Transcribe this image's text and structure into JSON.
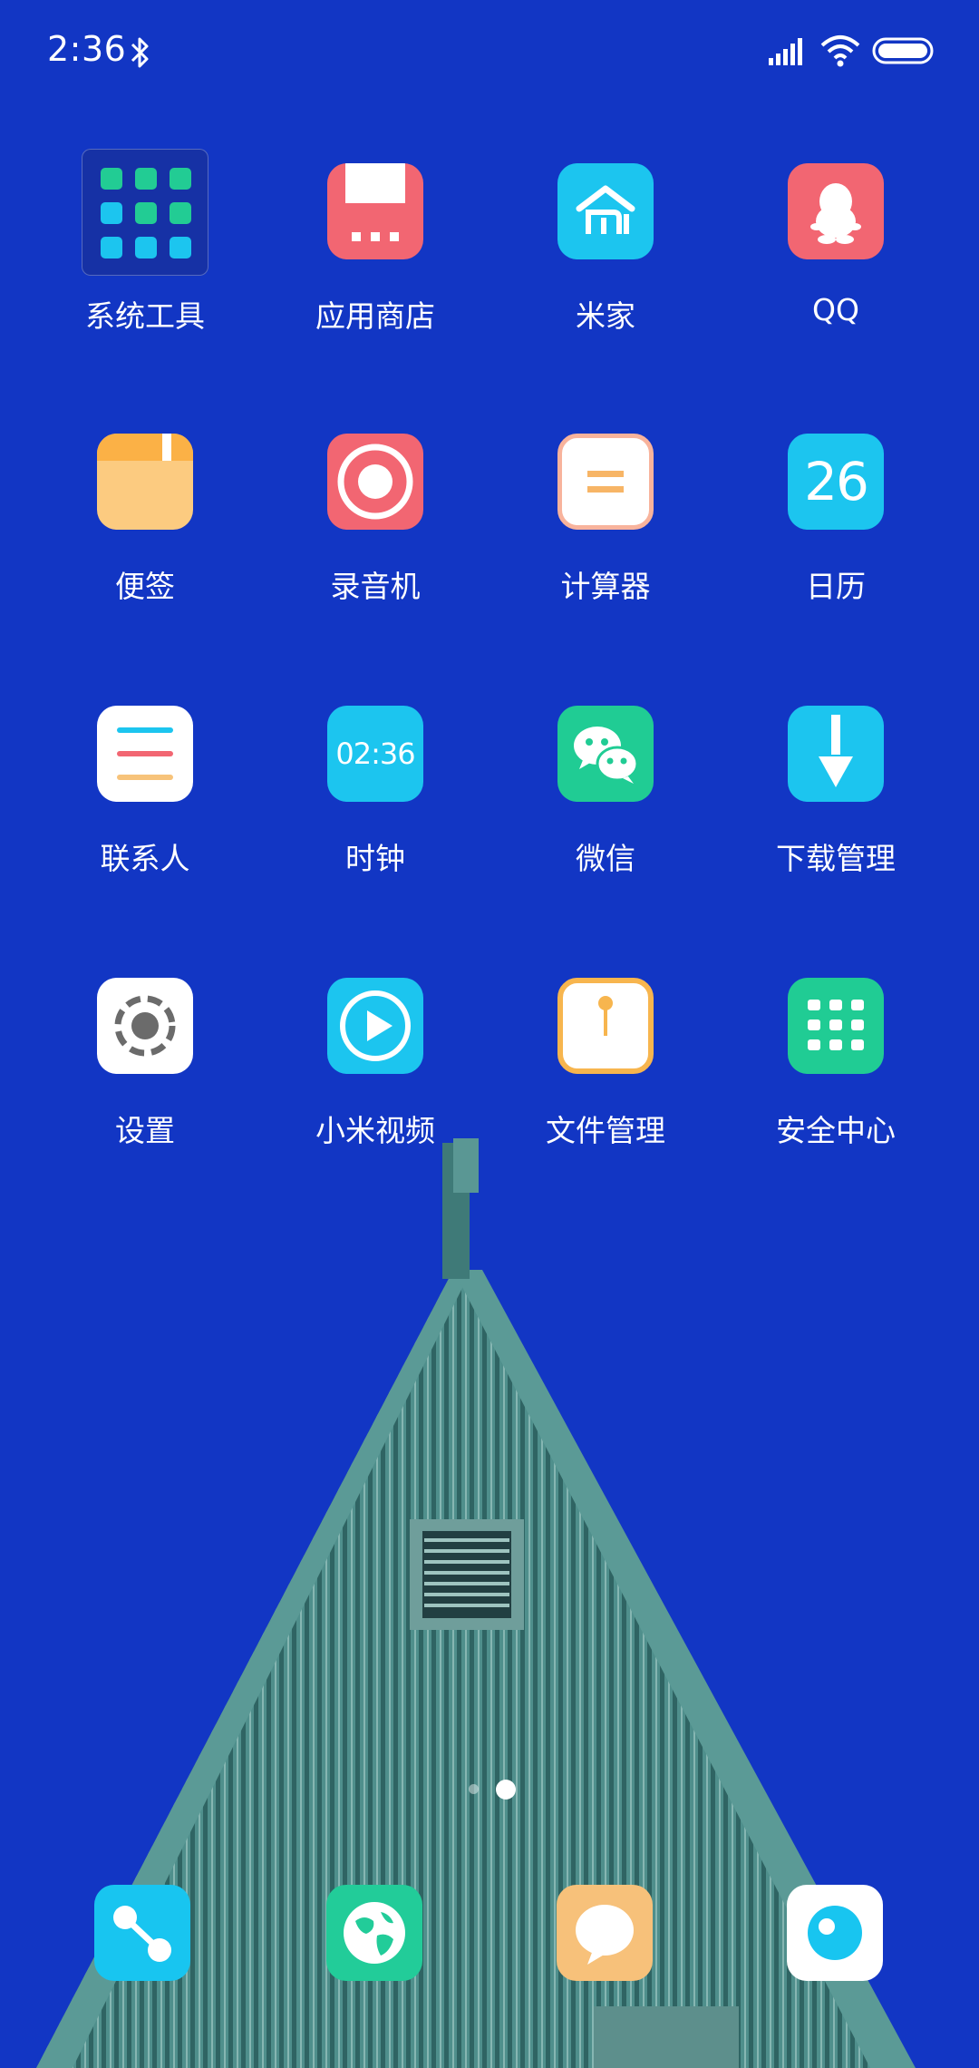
{
  "status_bar": {
    "time": "2:36"
  },
  "home": {
    "rows": [
      [
        {
          "label": "系统工具",
          "icon": "folder-icon"
        },
        {
          "label": "应用商店",
          "icon": "app-store-icon"
        },
        {
          "label": "米家",
          "icon": "mi-home-icon"
        },
        {
          "label": "QQ",
          "icon": "qq-penguin-icon"
        }
      ],
      [
        {
          "label": "便签",
          "icon": "notes-icon"
        },
        {
          "label": "录音机",
          "icon": "recorder-icon"
        },
        {
          "label": "计算器",
          "icon": "calculator-icon"
        },
        {
          "label": "日历",
          "icon": "calendar-icon",
          "badge": "26"
        }
      ],
      [
        {
          "label": "联系人",
          "icon": "contacts-icon"
        },
        {
          "label": "时钟",
          "icon": "clock-icon",
          "badge": "02:36"
        },
        {
          "label": "微信",
          "icon": "wechat-icon"
        },
        {
          "label": "下载管理",
          "icon": "download-icon"
        }
      ],
      [
        {
          "label": "设置",
          "icon": "settings-icon"
        },
        {
          "label": "小米视频",
          "icon": "video-icon"
        },
        {
          "label": "文件管理",
          "icon": "file-manager-icon"
        },
        {
          "label": "安全中心",
          "icon": "security-icon"
        }
      ]
    ]
  },
  "page_indicator": {
    "pages": 2,
    "current": 2
  },
  "dock": [
    {
      "icon": "share-icon",
      "color": "#18c5f0"
    },
    {
      "icon": "browser-globe-icon",
      "color": "#22cc99"
    },
    {
      "icon": "messages-icon",
      "color": "#f7c17a"
    },
    {
      "icon": "camera-icon",
      "color": "#ffffff"
    }
  ],
  "colors": {
    "background": "#1236c4",
    "roof": "#4a8a88",
    "red_tile": "#f26672",
    "blue_tile": "#1cc5ef",
    "green_tile": "#20cc94",
    "orange_tile": "#f9b05a"
  }
}
